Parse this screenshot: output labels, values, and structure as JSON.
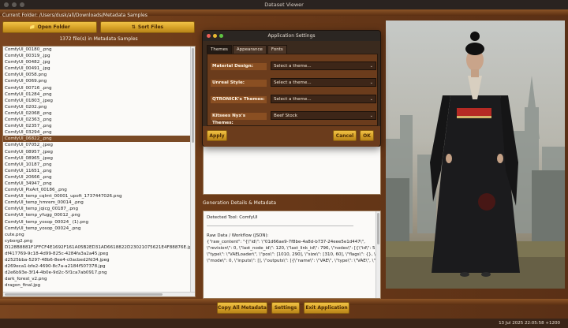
{
  "window": {
    "title": "Dataset Viewer"
  },
  "toolbar": {
    "current_folder": "Current Folder: /Users/dusk/all/Downloads/Metadata Samples",
    "open_folder_label": "Open Folder",
    "sort_files_label": "Sort Files",
    "file_count": "1372 file(s) in Metadata Samples"
  },
  "files": {
    "items": [
      "ComfyUI_00180_.png",
      "ComfyUI_00319_.jpg",
      "ComfyUI_00482_.jpg",
      "ComfyUI_00491_.jpg",
      "ComfyUI_0058.png",
      "ComfyUI_0069.png",
      "ComfyUI_00716_.png",
      "ComfyUI_01284_.png",
      "ComfyUI_01803_.jpeg",
      "ComfyUI_0202.png",
      "ComfyUI_02068_.png",
      "ComfyUI_02363_.png",
      "ComfyUI_02357_.png",
      "ComfyUI_03294_.png",
      "ComfyUI_06822_.png",
      "ComfyUI_07052_.jpeg",
      "ComfyUI_08957_.jpeg",
      "ComfyUI_08965_.jpeg",
      "ComfyUI_10187_.png",
      "ComfyUI_11651_.png",
      "ComfyUI_20666_.png",
      "ComfyUI_34947_.png",
      "ComfyUI_PixArt_00186_.png",
      "ComfyUI_temp_cqlmt_00001_upoft_1737447026.png",
      "ComfyUI_temp_hmrem_00014_.png",
      "ComfyUI_temp_jqicg_00187_.png",
      "ComfyUI_temp_yfugg_00012_.png",
      "ComfyUI_temp_yosop_00024_ (1).png",
      "ComfyUI_temp_yosop_00024_.png",
      "cute.png",
      "cyborg2.png",
      "D128B8881F1FFCF4E1692F161A05B2ED31AD6618822D23021075621E4F88876E.jpeg",
      "df417769-9c18-4d99-825c-4284fa3a2a45.jpeg",
      "d2525bba-5297-48b6-8ee4-c0acbed2fd34.jpeg",
      "d269eca1-bfe2-4690-8c7a-a2184f507378.jpg",
      "d2e6b93e-3f14-4b0e-9d2c-5f1ca7ab0917.png",
      "dark_forest_v2.png",
      "dragon_final.jpg"
    ],
    "selected_index": 14
  },
  "details": {
    "heading": "Generation Details & Metadata",
    "lines": [
      "Detected Tool: ComfyUI",
      "Raw Data / Workflow (JSON):",
      "{\"raw_content\": \"{\\\"id\\\": \\\"01d66ae9-7f8be-4a8d-b737-24eee5e1d447\\\",",
      "\\\"revision\\\": 0, \\\"last_node_id\\\": 120, \\\"last_link_id\\\": 796, \\\"nodes\\\": [{\\\"id\\\": 55,",
      "\\\"type\\\": \\\"VAELoader\\\", \\\"pos\\\": [1010, 290], \\\"size\\\": [310, 60], \\\"flags\\\": {}, \\\"order\\\": 0,",
      "\\\"mode\\\": 0, \\\"inputs\\\": [], \\\"outputs\\\": [{\\\"name\\\": \\\"VAE\\\", \\\"type\\\": \\\"VAE\\\", \\\"links\\\": [107,"
    ]
  },
  "actions": {
    "copy_all": "Copy All Metadata",
    "settings": "Settings",
    "exit": "Exit Application"
  },
  "status": {
    "timestamp": "13 Jul 2025 22:05:58 +1200"
  },
  "dialog": {
    "title": "Application Settings",
    "tabs": [
      "Themes",
      "Appearance",
      "Fonts"
    ],
    "active_tab": 0,
    "rows": [
      {
        "label": "Material Design:",
        "value": "Select a theme..."
      },
      {
        "label": "Unreal Style:",
        "value": "Select a theme..."
      },
      {
        "label": "QTRONICK's Themes:",
        "value": "Select a theme..."
      },
      {
        "label": "Kitsees Nyx's Themes:",
        "value": "Beef Stock"
      }
    ],
    "apply_label": "Apply",
    "cancel_label": "Cancel",
    "ok_label": "OK"
  },
  "colors": {
    "accent_gold": "#e0ad33",
    "brown_bg": "#6b3a18",
    "selection": "#7a4a26"
  }
}
